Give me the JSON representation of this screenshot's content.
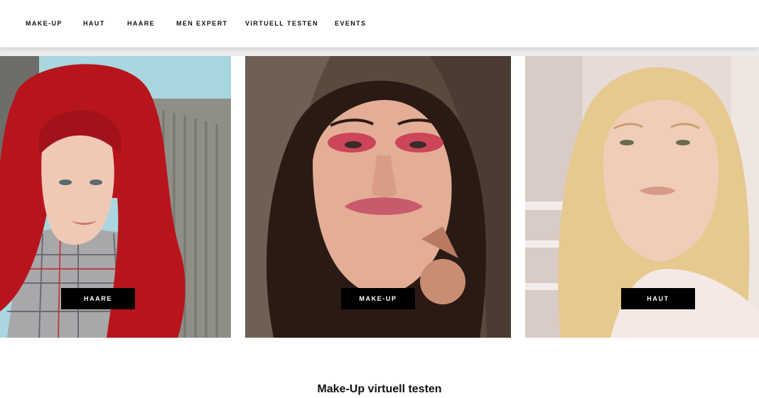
{
  "nav": {
    "items": [
      {
        "label": "MAKE-UP"
      },
      {
        "label": "HAUT"
      },
      {
        "label": "HAARE"
      },
      {
        "label": "MEN EXPERT"
      },
      {
        "label": "VIRTUELL TESTEN"
      },
      {
        "label": "EVENTS"
      }
    ]
  },
  "tiles": [
    {
      "button_label": "HAARE",
      "hair_color": "#b8141c",
      "background": "#a9d6e0"
    },
    {
      "button_label": "MAKE-UP",
      "hair_color": "#2a1a14",
      "accent": "#c8334f"
    },
    {
      "button_label": "HAUT",
      "hair_color": "#e6c98f",
      "background": "#e6dbd6"
    }
  ],
  "section": {
    "title": "Make-Up virtuell testen"
  }
}
